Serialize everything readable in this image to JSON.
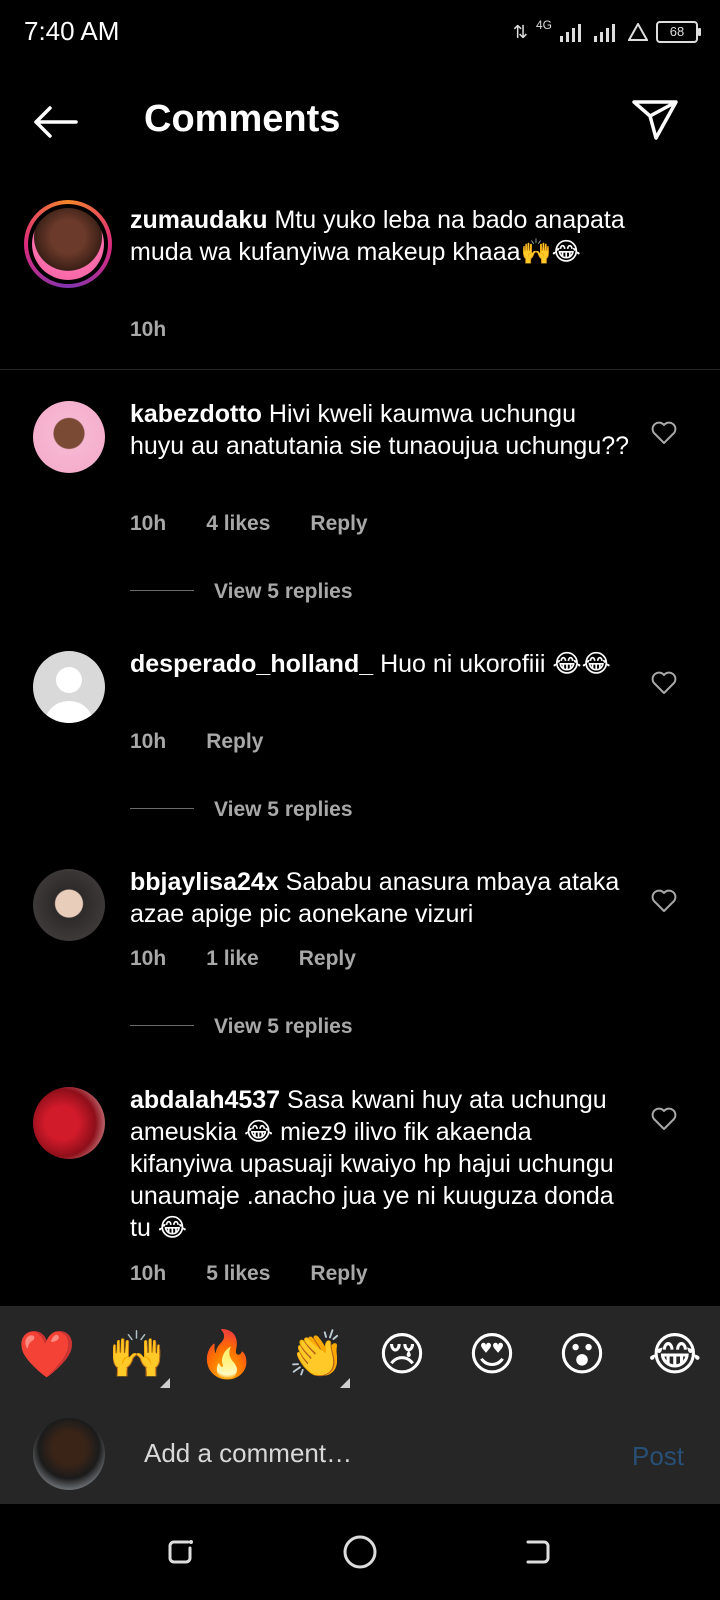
{
  "status": {
    "time": "7:40 AM",
    "network": "4G",
    "battery": "68"
  },
  "header": {
    "title": "Comments"
  },
  "caption": {
    "username": "zumaudaku",
    "text": "Mtu yuko leba na bado anapata muda wa kufanyiwa makeup khaaa🙌😂",
    "time": "10h"
  },
  "comments": [
    {
      "username": "kabezdotto",
      "text": "Hivi kweli kaumwa uchungu huyu au anatutania sie tunaoujua uchungu??",
      "time": "10h",
      "likes": "4 likes",
      "reply": "Reply",
      "view_replies": "View 5 replies"
    },
    {
      "username": "desperado_holland_",
      "text": "Huo ni ukorofiii 😂😂",
      "time": "10h",
      "reply": "Reply",
      "view_replies": "View 5 replies"
    },
    {
      "username": "bbjaylisa24x",
      "text": "Sababu anasura mbaya ataka azae apige pic aonekane vizuri",
      "time": "10h",
      "likes": "1 like",
      "reply": "Reply",
      "view_replies": "View 5 replies"
    },
    {
      "username": "abdalah4537",
      "text": "Sasa kwani huy ata uchungu ameuskia 😂 miez9 ilivo fik akaenda kifanyiwa upasuaji kwaiyo hp hajui uchungu unaumaje .anacho jua ye ni kuuguza donda tu 😂",
      "time": "10h",
      "likes": "5 likes",
      "reply": "Reply"
    }
  ],
  "reactions": [
    "❤️",
    "🙌",
    "🔥",
    "👏",
    "😢",
    "😍",
    "😮",
    "😂"
  ],
  "composer": {
    "placeholder": "Add a comment…",
    "post_label": "Post"
  },
  "colors": {
    "background": "#000000",
    "secondary_text": "#a8a8a8",
    "post_disabled": "#284f75",
    "bar": "#262626"
  }
}
